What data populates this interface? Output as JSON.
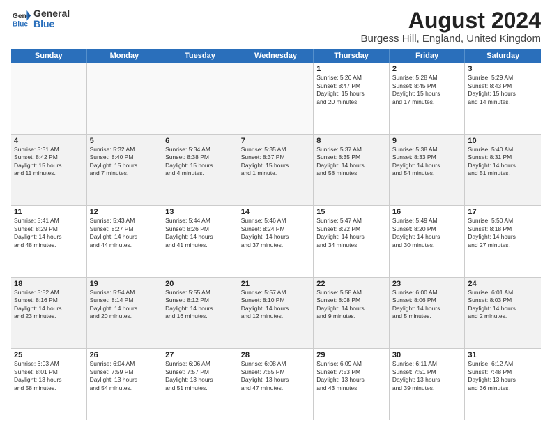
{
  "header": {
    "logo_general": "General",
    "logo_blue": "Blue",
    "title": "August 2024",
    "subtitle": "Burgess Hill, England, United Kingdom"
  },
  "weekdays": [
    "Sunday",
    "Monday",
    "Tuesday",
    "Wednesday",
    "Thursday",
    "Friday",
    "Saturday"
  ],
  "weeks": [
    [
      {
        "day": "",
        "text": "",
        "empty": true
      },
      {
        "day": "",
        "text": "",
        "empty": true
      },
      {
        "day": "",
        "text": "",
        "empty": true
      },
      {
        "day": "",
        "text": "",
        "empty": true
      },
      {
        "day": "1",
        "text": "Sunrise: 5:26 AM\nSunset: 8:47 PM\nDaylight: 15 hours\nand 20 minutes."
      },
      {
        "day": "2",
        "text": "Sunrise: 5:28 AM\nSunset: 8:45 PM\nDaylight: 15 hours\nand 17 minutes."
      },
      {
        "day": "3",
        "text": "Sunrise: 5:29 AM\nSunset: 8:43 PM\nDaylight: 15 hours\nand 14 minutes."
      }
    ],
    [
      {
        "day": "4",
        "text": "Sunrise: 5:31 AM\nSunset: 8:42 PM\nDaylight: 15 hours\nand 11 minutes."
      },
      {
        "day": "5",
        "text": "Sunrise: 5:32 AM\nSunset: 8:40 PM\nDaylight: 15 hours\nand 7 minutes."
      },
      {
        "day": "6",
        "text": "Sunrise: 5:34 AM\nSunset: 8:38 PM\nDaylight: 15 hours\nand 4 minutes."
      },
      {
        "day": "7",
        "text": "Sunrise: 5:35 AM\nSunset: 8:37 PM\nDaylight: 15 hours\nand 1 minute."
      },
      {
        "day": "8",
        "text": "Sunrise: 5:37 AM\nSunset: 8:35 PM\nDaylight: 14 hours\nand 58 minutes."
      },
      {
        "day": "9",
        "text": "Sunrise: 5:38 AM\nSunset: 8:33 PM\nDaylight: 14 hours\nand 54 minutes."
      },
      {
        "day": "10",
        "text": "Sunrise: 5:40 AM\nSunset: 8:31 PM\nDaylight: 14 hours\nand 51 minutes."
      }
    ],
    [
      {
        "day": "11",
        "text": "Sunrise: 5:41 AM\nSunset: 8:29 PM\nDaylight: 14 hours\nand 48 minutes."
      },
      {
        "day": "12",
        "text": "Sunrise: 5:43 AM\nSunset: 8:27 PM\nDaylight: 14 hours\nand 44 minutes."
      },
      {
        "day": "13",
        "text": "Sunrise: 5:44 AM\nSunset: 8:26 PM\nDaylight: 14 hours\nand 41 minutes."
      },
      {
        "day": "14",
        "text": "Sunrise: 5:46 AM\nSunset: 8:24 PM\nDaylight: 14 hours\nand 37 minutes."
      },
      {
        "day": "15",
        "text": "Sunrise: 5:47 AM\nSunset: 8:22 PM\nDaylight: 14 hours\nand 34 minutes."
      },
      {
        "day": "16",
        "text": "Sunrise: 5:49 AM\nSunset: 8:20 PM\nDaylight: 14 hours\nand 30 minutes."
      },
      {
        "day": "17",
        "text": "Sunrise: 5:50 AM\nSunset: 8:18 PM\nDaylight: 14 hours\nand 27 minutes."
      }
    ],
    [
      {
        "day": "18",
        "text": "Sunrise: 5:52 AM\nSunset: 8:16 PM\nDaylight: 14 hours\nand 23 minutes."
      },
      {
        "day": "19",
        "text": "Sunrise: 5:54 AM\nSunset: 8:14 PM\nDaylight: 14 hours\nand 20 minutes."
      },
      {
        "day": "20",
        "text": "Sunrise: 5:55 AM\nSunset: 8:12 PM\nDaylight: 14 hours\nand 16 minutes."
      },
      {
        "day": "21",
        "text": "Sunrise: 5:57 AM\nSunset: 8:10 PM\nDaylight: 14 hours\nand 12 minutes."
      },
      {
        "day": "22",
        "text": "Sunrise: 5:58 AM\nSunset: 8:08 PM\nDaylight: 14 hours\nand 9 minutes."
      },
      {
        "day": "23",
        "text": "Sunrise: 6:00 AM\nSunset: 8:06 PM\nDaylight: 14 hours\nand 5 minutes."
      },
      {
        "day": "24",
        "text": "Sunrise: 6:01 AM\nSunset: 8:03 PM\nDaylight: 14 hours\nand 2 minutes."
      }
    ],
    [
      {
        "day": "25",
        "text": "Sunrise: 6:03 AM\nSunset: 8:01 PM\nDaylight: 13 hours\nand 58 minutes."
      },
      {
        "day": "26",
        "text": "Sunrise: 6:04 AM\nSunset: 7:59 PM\nDaylight: 13 hours\nand 54 minutes."
      },
      {
        "day": "27",
        "text": "Sunrise: 6:06 AM\nSunset: 7:57 PM\nDaylight: 13 hours\nand 51 minutes."
      },
      {
        "day": "28",
        "text": "Sunrise: 6:08 AM\nSunset: 7:55 PM\nDaylight: 13 hours\nand 47 minutes."
      },
      {
        "day": "29",
        "text": "Sunrise: 6:09 AM\nSunset: 7:53 PM\nDaylight: 13 hours\nand 43 minutes."
      },
      {
        "day": "30",
        "text": "Sunrise: 6:11 AM\nSunset: 7:51 PM\nDaylight: 13 hours\nand 39 minutes."
      },
      {
        "day": "31",
        "text": "Sunrise: 6:12 AM\nSunset: 7:48 PM\nDaylight: 13 hours\nand 36 minutes."
      }
    ]
  ]
}
